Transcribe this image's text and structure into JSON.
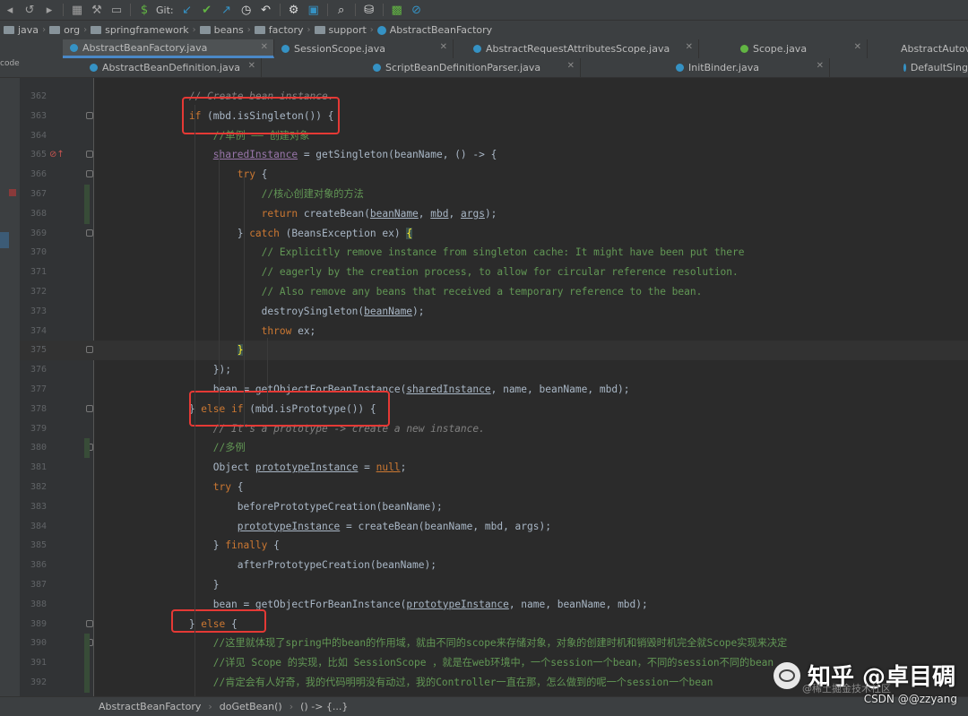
{
  "toolbar": {
    "git_label": "Git:",
    "icons": [
      "undo-icon",
      "redo-icon",
      "build-icon",
      "run-config-icon",
      "git-update-icon",
      "git-commit-icon",
      "git-push-icon",
      "history-icon",
      "rollback-icon",
      "settings-wrench-icon",
      "project-structure-icon",
      "search-icon",
      "database-icon",
      "vcs-icon",
      "no-entry-icon"
    ]
  },
  "breadcrumb": [
    "java",
    "org",
    "springframework",
    "beans",
    "factory",
    "support",
    "AbstractBeanFactory"
  ],
  "tabs_row1": [
    {
      "label": "AbstractBeanFactory.java",
      "active": true
    },
    {
      "label": "SessionScope.java",
      "active": false
    },
    {
      "label": "AbstractRequestAttributesScope.java",
      "active": false
    },
    {
      "label": "Scope.java",
      "active": false
    },
    {
      "label": "AbstractAutov",
      "active": false
    }
  ],
  "tabs_row2": [
    {
      "label": "AbstractBeanDefinition.java"
    },
    {
      "label": "ScriptBeanDefinitionParser.java"
    },
    {
      "label": "InitBinder.java"
    },
    {
      "label": "DefaultSing"
    }
  ],
  "side_label": "code",
  "lines": [
    {
      "n": "362",
      "html": "            <span class='cmo'>// Create bean instance.</span>"
    },
    {
      "n": "363",
      "html": "            <span class='kw'>if</span> (mbd.isSingleton()) {"
    },
    {
      "n": "364",
      "html": "                <span class='cm'>//单例 —— 创建对象</span>"
    },
    {
      "n": "365",
      "html": "                <span class='pr ul'>sharedInstance</span> = getSingleton(beanName, () -> {"
    },
    {
      "n": "366",
      "html": "                    <span class='kw'>try</span> {"
    },
    {
      "n": "367",
      "html": "                        <span class='cm'>//核心创建对象的方法</span>"
    },
    {
      "n": "368",
      "html": "                        <span class='kw'>return</span> createBean(<span class='ul'>beanName</span>, <span class='ul'>mbd</span>, <span class='ul'>args</span>);"
    },
    {
      "n": "369",
      "html": "                    } <span class='kw'>catch</span> (BeansException ex) <span class='brk'>{</span>"
    },
    {
      "n": "370",
      "html": "                        <span class='cm'>// Explicitly remove instance from singleton cache: It might have been put there</span>"
    },
    {
      "n": "371",
      "html": "                        <span class='cm'>// eagerly by the creation process, to allow for circular reference resolution.</span>"
    },
    {
      "n": "372",
      "html": "                        <span class='cm'>// Also remove any beans that received a temporary reference to the bean.</span>"
    },
    {
      "n": "373",
      "html": "                        destroySingleton(<span class='ul'>beanName</span>);"
    },
    {
      "n": "374",
      "html": "                        <span class='kw'>throw</span> ex;"
    },
    {
      "n": "375",
      "html": "                    <span class='brk'>}</span>"
    },
    {
      "n": "376",
      "html": "                });"
    },
    {
      "n": "377",
      "html": "                bean = getObjectForBeanInstance(<span class='ul'>sharedInstance</span>, name, beanName, mbd);"
    },
    {
      "n": "378",
      "html": "            } <span class='kw'>else if</span> (mbd.isPrototype()) {"
    },
    {
      "n": "379",
      "html": "                <span class='cmo'>// It's a prototype -> create a new instance.</span>"
    },
    {
      "n": "380",
      "html": "                <span class='cm'>//多例</span>"
    },
    {
      "n": "381",
      "html": "                Object <span class='ul'>prototypeInstance</span> = <span class='kw ul'>null</span>;"
    },
    {
      "n": "382",
      "html": "                <span class='kw'>try</span> {"
    },
    {
      "n": "383",
      "html": "                    beforePrototypeCreation(beanName);"
    },
    {
      "n": "384",
      "html": "                    <span class='ul'>prototypeInstance</span> = createBean(beanName, mbd, args);"
    },
    {
      "n": "385",
      "html": "                } <span class='kw'>finally</span> {"
    },
    {
      "n": "386",
      "html": "                    afterPrototypeCreation(beanName);"
    },
    {
      "n": "387",
      "html": "                }"
    },
    {
      "n": "388",
      "html": "                bean = getObjectForBeanInstance(<span class='ul'>prototypeInstance</span>, name, beanName, mbd);"
    },
    {
      "n": "389",
      "html": "            } <span class='kw'>else</span> {"
    },
    {
      "n": "390",
      "html": "                <span class='cm'>//这里就体现了spring中的bean的作用域，就由不同的scope来存储对象，对象的创建时机和销毁时机完全就Scope实现来决定</span>"
    },
    {
      "n": "391",
      "html": "                <span class='cm'>//详见 Scope 的实现，比如 SessionScope ，就是在web环境中，一个session一个bean，不同的session不同的bean</span>"
    },
    {
      "n": "392",
      "html": "                <span class='cm'>//肯定会有人好奇，我的代码明明没有动过，我的Controller一直在那，怎么做到的呢一个session一个bean</span>"
    }
  ],
  "statusbar": [
    "AbstractBeanFactory",
    "doGetBean()",
    "() -> {...}"
  ],
  "watermark": {
    "main": "知乎 @卓目碉",
    "sub": "@稀土掘金技术社区"
  },
  "csdn": "CSDN @@zzyang"
}
